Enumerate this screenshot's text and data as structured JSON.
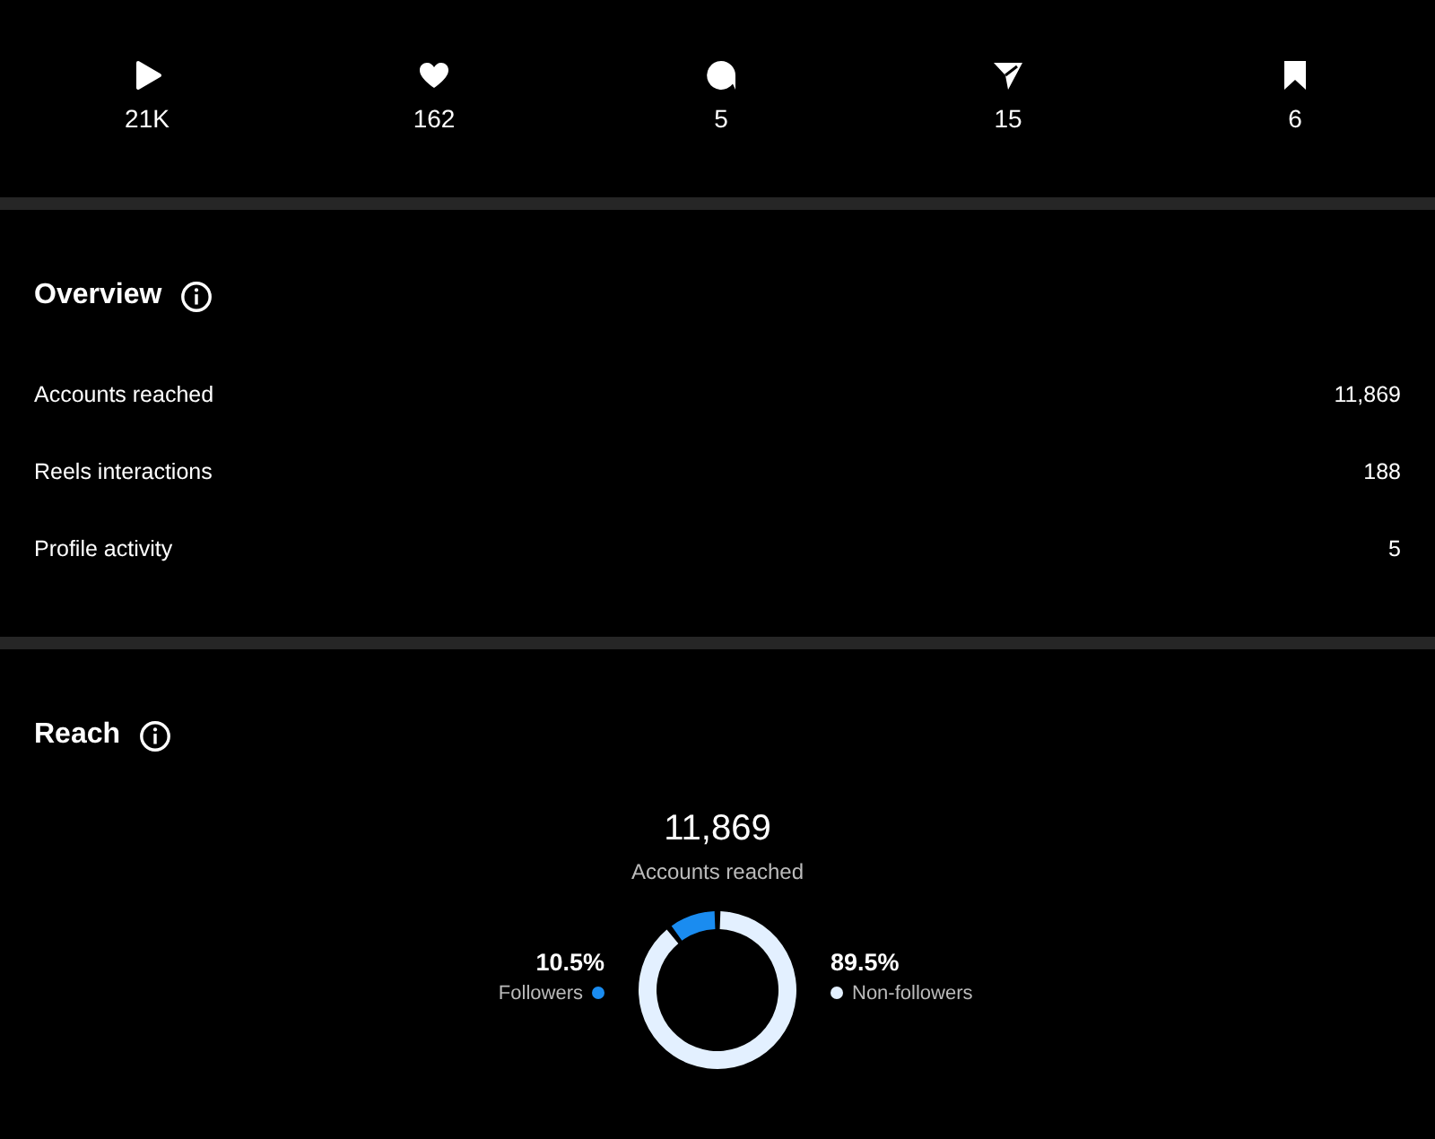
{
  "stats": [
    {
      "kind": "plays",
      "value": "21K"
    },
    {
      "kind": "likes",
      "value": "162"
    },
    {
      "kind": "comments",
      "value": "5"
    },
    {
      "kind": "shares",
      "value": "15"
    },
    {
      "kind": "saves",
      "value": "6"
    }
  ],
  "overview": {
    "title": "Overview",
    "rows": [
      {
        "label": "Accounts reached",
        "value": "11,869"
      },
      {
        "label": "Reels interactions",
        "value": "188"
      },
      {
        "label": "Profile activity",
        "value": "5"
      }
    ]
  },
  "reach": {
    "title": "Reach",
    "total": "11,869",
    "total_label": "Accounts reached",
    "chart_data": {
      "type": "donut",
      "categories": [
        "Followers",
        "Non-followers"
      ],
      "values": [
        10.5,
        89.5
      ],
      "colors": [
        "#1a8cf0",
        "#e3f0ff"
      ]
    },
    "legend": [
      {
        "percent": "10.5%",
        "color": "#1a8cf0"
      },
      {
        "percent": "89.5%",
        "color": "#e3f0ff"
      }
    ]
  }
}
